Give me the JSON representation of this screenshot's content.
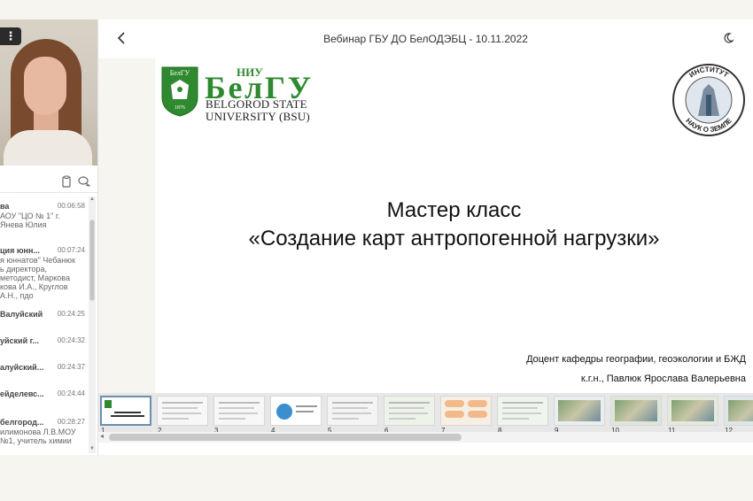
{
  "header": {
    "title": "Вебинар ГБУ ДО БелОДЭБЦ - 10.11.2022"
  },
  "video": {
    "menu_label": "⋮"
  },
  "chat": {
    "messages": [
      {
        "name": "ва",
        "time": "00:06:58",
        "lines": [
          "АОУ \"ЦО № 1\" г.",
          "Янева Юлия"
        ]
      },
      {
        "name": "ция юнн...",
        "time": "00:07:24",
        "lines": [
          "я юннатов\" Чебанюк",
          "ь директора,",
          "методист, Маркова",
          "кова И.А., Круглов",
          "А.Н., пдо"
        ]
      },
      {
        "name": "Валуйский",
        "time": "00:24:25",
        "lines": []
      },
      {
        "name": "уйский г...",
        "time": "00:24:32",
        "lines": []
      },
      {
        "name": "алуйский...",
        "time": "00:24:37",
        "lines": []
      },
      {
        "name": "ейделевс...",
        "time": "00:24:44",
        "lines": []
      },
      {
        "name": "белгород...",
        "time": "00:28:27",
        "lines": [
          "илимонова Л.В.МОУ",
          "№1, учитель химии"
        ]
      }
    ]
  },
  "slide": {
    "logo_top": "НИУ",
    "logo_main": "БелГУ",
    "shield_text": "БелГУ",
    "shield_year": "1876",
    "logo_sub1": "BELGOROD STATE",
    "logo_sub2": "UNIVERSITY (BSU)",
    "seal_top": "ИНСТИТУТ",
    "seal_bottom": "НАУК О ЗЕМЛЕ",
    "title_line1": "Мастер класс",
    "title_line2": "«Создание карт антропогенной нагрузки»",
    "author_line1": "Доцент кафедры географии, геоэкологии и БЖД",
    "author_line2": "к.г.н., Павлюк Ярослава Валерьевна"
  },
  "thumbnails": {
    "numbers": [
      "1",
      "2",
      "3",
      "4",
      "5",
      "6",
      "7",
      "8",
      "9",
      "10",
      "11",
      "12"
    ],
    "active_index": 0
  },
  "colors": {
    "bsu_green": "#2f8a2f",
    "accent": "#6b8fb0"
  },
  "icons": {
    "back": "chevron-left-icon",
    "theme": "moon-icon",
    "files": "clipboard-icon",
    "chat": "chat-bubbles-icon"
  }
}
